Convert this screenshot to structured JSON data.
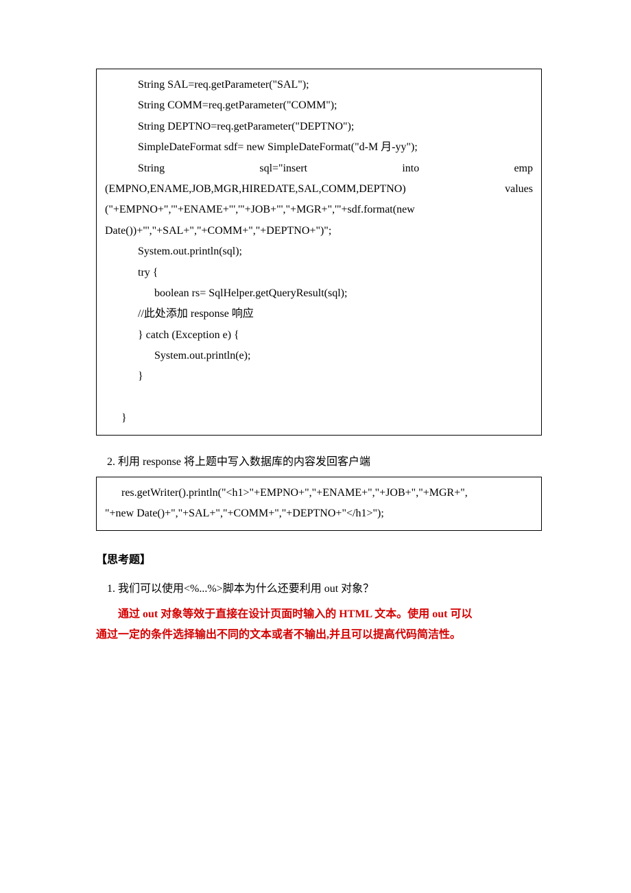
{
  "code1": {
    "l1": "String SAL=req.getParameter(\"SAL\");",
    "l2": "String COMM=req.getParameter(\"COMM\");",
    "l3": "String DEPTNO=req.getParameter(\"DEPTNO\");",
    "l4": "SimpleDateFormat sdf= new SimpleDateFormat(\"d-M 月-yy\");",
    "j1a": "String",
    "j1b": "sql=\"insert",
    "j1c": "into",
    "j1d": "emp",
    "j2a": "(EMPNO,ENAME,JOB,MGR,HIREDATE,SAL,COMM,DEPTNO)",
    "j2b": "values",
    "l7": "(\"+EMPNO+\",'\"+ENAME+\"','\"+JOB+\"',\"+MGR+\",'\"+sdf.format(new",
    "l8": "Date())+\"',\"+SAL+\",\"+COMM+\",\"+DEPTNO+\")\";",
    "l9": "System.out.println(sql);",
    "l10": "try {",
    "l11": "boolean rs= SqlHelper.getQueryResult(sql);",
    "l12": " //此处添加 response 响应",
    "l13": "} catch (Exception e) {",
    "l14": "System.out.println(e);",
    "l15": "}",
    "l16": "}"
  },
  "q2": "2.  利用 response 将上题中写入数据库的内容发回客户端",
  "code2": {
    "l1": "res.getWriter().println(\"<h1>\"+EMPNO+\",\"+ENAME+\",\"+JOB+\",\"+MGR+\",",
    "l2": "\"+new Date()+\",\"+SAL+\",\"+COMM+\",\"+DEPTNO+\"</h1>\");"
  },
  "sec": "【思考题】",
  "q1think": "1.  我们可以使用<%...%>脚本为什么还要利用 out 对象？",
  "ans1": "通过 out 对象等效于直接在设计页面时输入的 HTML 文本。使用 out 可以",
  "ans2": "通过一定的条件选择输出不同的文本或者不输出,并且可以提高代码简洁性。"
}
